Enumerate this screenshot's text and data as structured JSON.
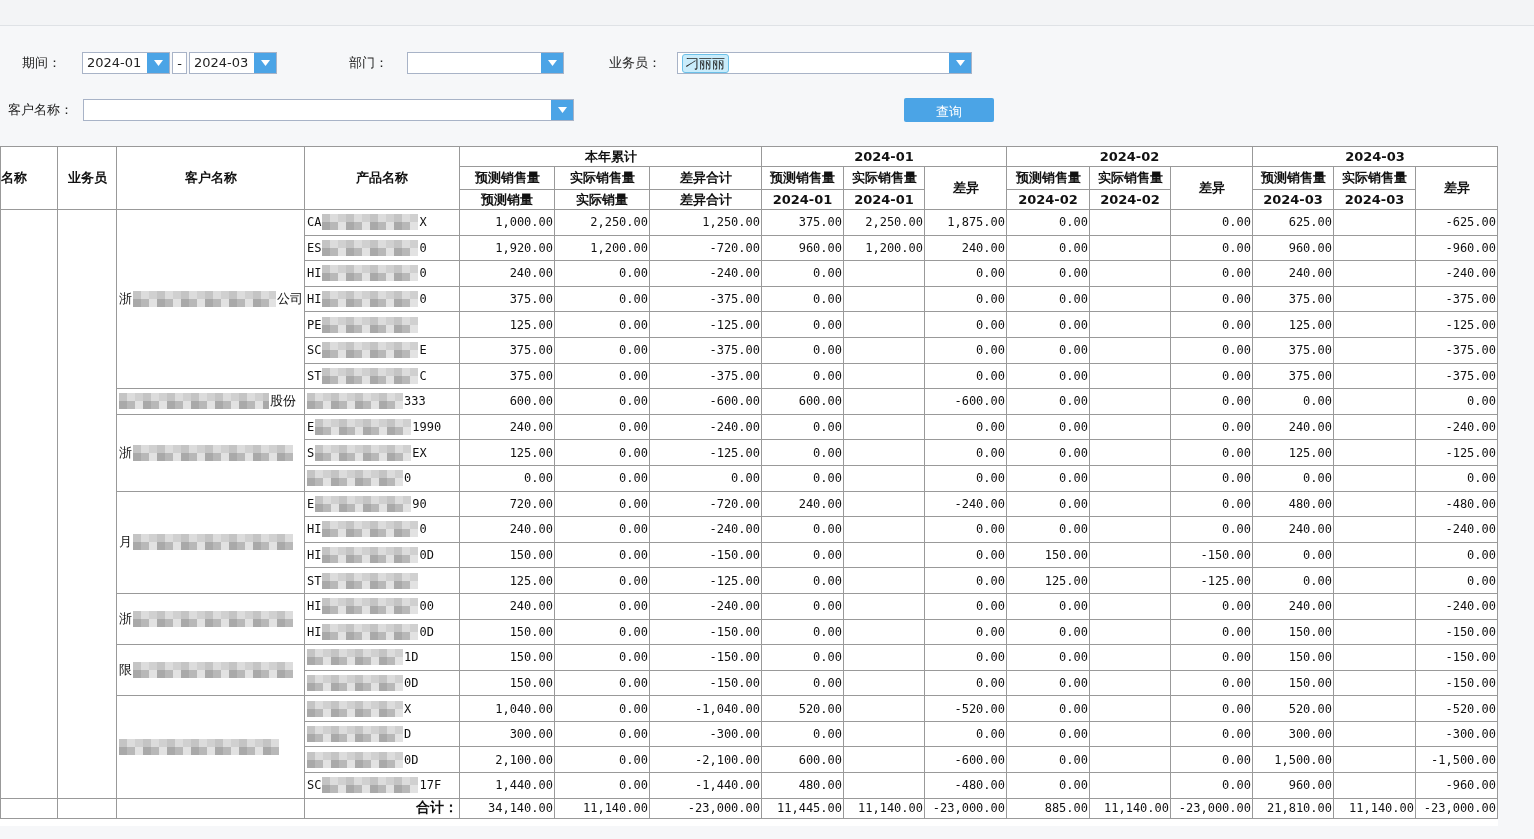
{
  "filters": {
    "period": {
      "label": "期间：",
      "from": "2024-01",
      "separator": "-",
      "to": "2024-03"
    },
    "department": {
      "label": "部门："
    },
    "salesperson": {
      "label": "业务员：",
      "tags": [
        "刁丽丽"
      ]
    },
    "customer": {
      "label": "客户名称："
    },
    "query_button": "查询"
  },
  "table": {
    "fixed_columns": [
      "名称",
      "业务员",
      "客户名称",
      "产品名称"
    ],
    "groups": [
      {
        "title": "本年累计",
        "columns": [
          {
            "line1": "预测销售量",
            "line2": "预测销量"
          },
          {
            "line1": "实际销售量",
            "line2": "实际销量"
          },
          {
            "line1": "差异合计",
            "line2": "差异合计"
          }
        ]
      },
      {
        "title": "2024-01",
        "columns": [
          {
            "line1": "预测销售量",
            "line2": "2024-01"
          },
          {
            "line1": "实际销售量",
            "line2": "2024-01"
          },
          {
            "line1": "差异"
          }
        ]
      },
      {
        "title": "2024-02",
        "columns": [
          {
            "line1": "预测销售量",
            "line2": "2024-02"
          },
          {
            "line1": "实际销售量",
            "line2": "2024-02"
          },
          {
            "line1": "差异"
          }
        ]
      },
      {
        "title": "2024-03",
        "columns": [
          {
            "line1": "预测销售量",
            "line2": "2024-03"
          },
          {
            "line1": "实际销售量",
            "line2": "2024-03"
          },
          {
            "line1": "差异"
          }
        ]
      }
    ],
    "customers": [
      {
        "head": "浙",
        "tail": "公司",
        "rows": [
          {
            "product_head": "CA",
            "product_tail": "X",
            "periods": [
              {
                "forecast": "1,000.00",
                "actual": "2,250.00",
                "diff": "1,250.00"
              },
              {
                "forecast": "375.00",
                "actual": "2,250.00",
                "diff": "1,875.00"
              },
              {
                "forecast": "0.00",
                "diff": "0.00"
              },
              {
                "forecast": "625.00",
                "diff": "-625.00"
              }
            ]
          },
          {
            "product_head": "ES",
            "product_tail": "0",
            "periods": [
              {
                "forecast": "1,920.00",
                "actual": "1,200.00",
                "diff": "-720.00"
              },
              {
                "forecast": "960.00",
                "actual": "1,200.00",
                "diff": "240.00"
              },
              {
                "forecast": "0.00",
                "diff": "0.00"
              },
              {
                "forecast": "960.00",
                "diff": "-960.00"
              }
            ]
          },
          {
            "product_head": "HI",
            "product_tail": "0",
            "periods": [
              {
                "forecast": "240.00",
                "actual": "0.00",
                "diff": "-240.00"
              },
              {
                "forecast": "0.00",
                "diff": "0.00"
              },
              {
                "forecast": "0.00",
                "diff": "0.00"
              },
              {
                "forecast": "240.00",
                "diff": "-240.00"
              }
            ]
          },
          {
            "product_head": "HI",
            "product_tail": "0",
            "periods": [
              {
                "forecast": "375.00",
                "actual": "0.00",
                "diff": "-375.00"
              },
              {
                "forecast": "0.00",
                "diff": "0.00"
              },
              {
                "forecast": "0.00",
                "diff": "0.00"
              },
              {
                "forecast": "375.00",
                "diff": "-375.00"
              }
            ]
          },
          {
            "product_head": "PE",
            "periods": [
              {
                "forecast": "125.00",
                "actual": "0.00",
                "diff": "-125.00"
              },
              {
                "forecast": "0.00",
                "diff": "0.00"
              },
              {
                "forecast": "0.00",
                "diff": "0.00"
              },
              {
                "forecast": "125.00",
                "diff": "-125.00"
              }
            ]
          },
          {
            "product_head": "SC",
            "product_tail": "E",
            "periods": [
              {
                "forecast": "375.00",
                "actual": "0.00",
                "diff": "-375.00"
              },
              {
                "forecast": "0.00",
                "diff": "0.00"
              },
              {
                "forecast": "0.00",
                "diff": "0.00"
              },
              {
                "forecast": "375.00",
                "diff": "-375.00"
              }
            ]
          },
          {
            "product_head": "ST",
            "product_tail": "C",
            "periods": [
              {
                "forecast": "375.00",
                "actual": "0.00",
                "diff": "-375.00"
              },
              {
                "forecast": "0.00",
                "diff": "0.00"
              },
              {
                "forecast": "0.00",
                "diff": "0.00"
              },
              {
                "forecast": "375.00",
                "diff": "-375.00"
              }
            ]
          }
        ]
      },
      {
        "tail": "股份",
        "rows": [
          {
            "product_tail": "333",
            "periods": [
              {
                "forecast": "600.00",
                "actual": "0.00",
                "diff": "-600.00"
              },
              {
                "forecast": "600.00",
                "diff": "-600.00"
              },
              {
                "forecast": "0.00",
                "diff": "0.00"
              },
              {
                "forecast": "0.00",
                "diff": "0.00"
              }
            ]
          }
        ]
      },
      {
        "head": "浙",
        "rows": [
          {
            "product_head": "E",
            "product_tail": "1990",
            "periods": [
              {
                "forecast": "240.00",
                "actual": "0.00",
                "diff": "-240.00"
              },
              {
                "forecast": "0.00",
                "diff": "0.00"
              },
              {
                "forecast": "0.00",
                "diff": "0.00"
              },
              {
                "forecast": "240.00",
                "diff": "-240.00"
              }
            ]
          },
          {
            "product_head": "S",
            "product_tail": "EX",
            "periods": [
              {
                "forecast": "125.00",
                "actual": "0.00",
                "diff": "-125.00"
              },
              {
                "forecast": "0.00",
                "diff": "0.00"
              },
              {
                "forecast": "0.00",
                "diff": "0.00"
              },
              {
                "forecast": "125.00",
                "diff": "-125.00"
              }
            ]
          },
          {
            "product_tail": "0",
            "periods": [
              {
                "forecast": "0.00",
                "actual": "0.00",
                "diff": "0.00"
              },
              {
                "forecast": "0.00",
                "diff": "0.00"
              },
              {
                "forecast": "0.00",
                "diff": "0.00"
              },
              {
                "forecast": "0.00",
                "diff": "0.00"
              }
            ]
          }
        ]
      },
      {
        "head": "月",
        "rows": [
          {
            "product_head": "E",
            "product_tail": "90",
            "periods": [
              {
                "forecast": "720.00",
                "actual": "0.00",
                "diff": "-720.00"
              },
              {
                "forecast": "240.00",
                "diff": "-240.00"
              },
              {
                "forecast": "0.00",
                "diff": "0.00"
              },
              {
                "forecast": "480.00",
                "diff": "-480.00"
              }
            ]
          },
          {
            "product_head": "HI",
            "product_tail": "0",
            "periods": [
              {
                "forecast": "240.00",
                "actual": "0.00",
                "diff": "-240.00"
              },
              {
                "forecast": "0.00",
                "diff": "0.00"
              },
              {
                "forecast": "0.00",
                "diff": "0.00"
              },
              {
                "forecast": "240.00",
                "diff": "-240.00"
              }
            ]
          },
          {
            "product_head": "HI",
            "product_tail": "0D",
            "periods": [
              {
                "forecast": "150.00",
                "actual": "0.00",
                "diff": "-150.00"
              },
              {
                "forecast": "0.00",
                "diff": "0.00"
              },
              {
                "forecast": "150.00",
                "diff": "-150.00"
              },
              {
                "forecast": "0.00",
                "diff": "0.00"
              }
            ]
          },
          {
            "product_head": "ST",
            "periods": [
              {
                "forecast": "125.00",
                "actual": "0.00",
                "diff": "-125.00"
              },
              {
                "forecast": "0.00",
                "diff": "0.00"
              },
              {
                "forecast": "125.00",
                "diff": "-125.00"
              },
              {
                "forecast": "0.00",
                "diff": "0.00"
              }
            ]
          }
        ]
      },
      {
        "head": "浙",
        "rows": [
          {
            "product_head": "HI",
            "product_tail": "00",
            "periods": [
              {
                "forecast": "240.00",
                "actual": "0.00",
                "diff": "-240.00"
              },
              {
                "forecast": "0.00",
                "diff": "0.00"
              },
              {
                "forecast": "0.00",
                "diff": "0.00"
              },
              {
                "forecast": "240.00",
                "diff": "-240.00"
              }
            ]
          },
          {
            "product_head": "HI",
            "product_tail": "0D",
            "periods": [
              {
                "forecast": "150.00",
                "actual": "0.00",
                "diff": "-150.00"
              },
              {
                "forecast": "0.00",
                "diff": "0.00"
              },
              {
                "forecast": "0.00",
                "diff": "0.00"
              },
              {
                "forecast": "150.00",
                "diff": "-150.00"
              }
            ]
          }
        ]
      },
      {
        "head": "限",
        "rows": [
          {
            "product_tail": "1D",
            "periods": [
              {
                "forecast": "150.00",
                "actual": "0.00",
                "diff": "-150.00"
              },
              {
                "forecast": "0.00",
                "diff": "0.00"
              },
              {
                "forecast": "0.00",
                "diff": "0.00"
              },
              {
                "forecast": "150.00",
                "diff": "-150.00"
              }
            ]
          },
          {
            "product_tail": "0D",
            "periods": [
              {
                "forecast": "150.00",
                "actual": "0.00",
                "diff": "-150.00"
              },
              {
                "forecast": "0.00",
                "diff": "0.00"
              },
              {
                "forecast": "0.00",
                "diff": "0.00"
              },
              {
                "forecast": "150.00",
                "diff": "-150.00"
              }
            ]
          }
        ]
      },
      {
        "rows": [
          {
            "product_tail": "X",
            "periods": [
              {
                "forecast": "1,040.00",
                "actual": "0.00",
                "diff": "-1,040.00"
              },
              {
                "forecast": "520.00",
                "diff": "-520.00"
              },
              {
                "forecast": "0.00",
                "diff": "0.00"
              },
              {
                "forecast": "520.00",
                "diff": "-520.00"
              }
            ]
          },
          {
            "product_tail": "D",
            "periods": [
              {
                "forecast": "300.00",
                "actual": "0.00",
                "diff": "-300.00"
              },
              {
                "forecast": "0.00",
                "diff": "0.00"
              },
              {
                "forecast": "0.00",
                "diff": "0.00"
              },
              {
                "forecast": "300.00",
                "diff": "-300.00"
              }
            ]
          },
          {
            "product_tail": "0D",
            "periods": [
              {
                "forecast": "2,100.00",
                "actual": "0.00",
                "diff": "-2,100.00"
              },
              {
                "forecast": "600.00",
                "diff": "-600.00"
              },
              {
                "forecast": "0.00",
                "diff": "0.00"
              },
              {
                "forecast": "1,500.00",
                "diff": "-1,500.00"
              }
            ]
          },
          {
            "product_head": "SC",
            "product_tail": "17F",
            "periods": [
              {
                "forecast": "1,440.00",
                "actual": "0.00",
                "diff": "-1,440.00"
              },
              {
                "forecast": "480.00",
                "diff": "-480.00"
              },
              {
                "forecast": "0.00",
                "diff": "0.00"
              },
              {
                "forecast": "960.00",
                "diff": "-960.00"
              }
            ]
          }
        ]
      }
    ],
    "total": {
      "label": "合计：",
      "periods": [
        {
          "forecast": "34,140.00",
          "actual": "11,140.00",
          "diff": "-23,000.00"
        },
        {
          "forecast": "11,445.00",
          "actual": "11,140.00",
          "diff": "-23,000.00"
        },
        {
          "forecast": "885.00",
          "actual": "11,140.00",
          "diff": "-23,000.00"
        },
        {
          "forecast": "21,810.00",
          "actual": "11,140.00",
          "diff": "-23,000.00"
        }
      ]
    }
  }
}
